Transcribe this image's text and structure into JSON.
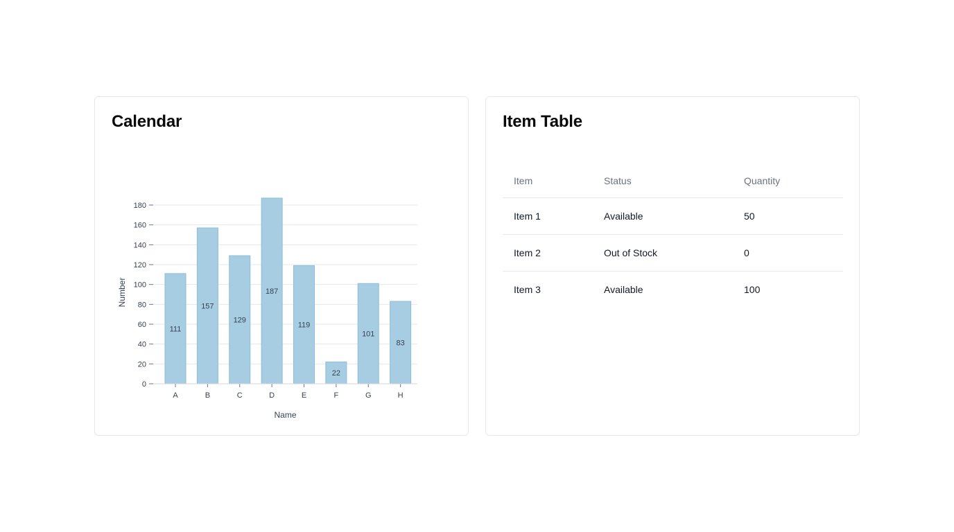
{
  "left_card": {
    "title": "Calendar"
  },
  "right_card": {
    "title": "Item Table"
  },
  "chart_data": {
    "type": "bar",
    "categories": [
      "A",
      "B",
      "C",
      "D",
      "E",
      "F",
      "G",
      "H"
    ],
    "values": [
      111,
      157,
      129,
      187,
      119,
      22,
      101,
      83
    ],
    "title": "",
    "xlabel": "Name",
    "ylabel": "Number",
    "ylim": [
      0,
      180
    ],
    "yticks": [
      0,
      20,
      40,
      60,
      80,
      100,
      120,
      140,
      160,
      180
    ],
    "grid": true,
    "bar_color": "#a6cde2",
    "bar_edge_color": "#8fbdd6",
    "data_labels": true
  },
  "table": {
    "headers": {
      "item": "Item",
      "status": "Status",
      "quantity": "Quantity"
    },
    "rows": [
      {
        "item": "Item 1",
        "status": "Available",
        "quantity": "50"
      },
      {
        "item": "Item 2",
        "status": "Out of Stock",
        "quantity": "0"
      },
      {
        "item": "Item 3",
        "status": "Available",
        "quantity": "100"
      }
    ]
  }
}
